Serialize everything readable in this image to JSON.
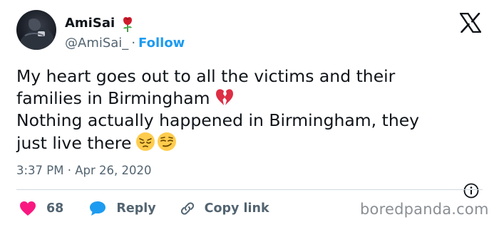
{
  "author": {
    "display_name": "AmiSai",
    "handle": "@AmiSai_",
    "separator": "·",
    "follow_label": "Follow",
    "name_emoji": "rose-icon"
  },
  "tweet": {
    "lines": [
      "My heart goes out to all the victims and their",
      "families in Birmingham",
      "Nothing actually happened in Birmingham, they",
      "just live there"
    ],
    "emojis": [
      "broken-heart-icon",
      "pensive-face-icon",
      "smirking-face-icon"
    ],
    "timestamp": "3:37 PM · Apr 26, 2020"
  },
  "actions": {
    "like_count": "68",
    "reply_label": "Reply",
    "copy_link_label": "Copy link"
  },
  "watermark": "boredpanda.com",
  "colors": {
    "accent": "#1d9bf0",
    "like": "#f91880",
    "text": "#0f1419",
    "muted": "#536471"
  }
}
